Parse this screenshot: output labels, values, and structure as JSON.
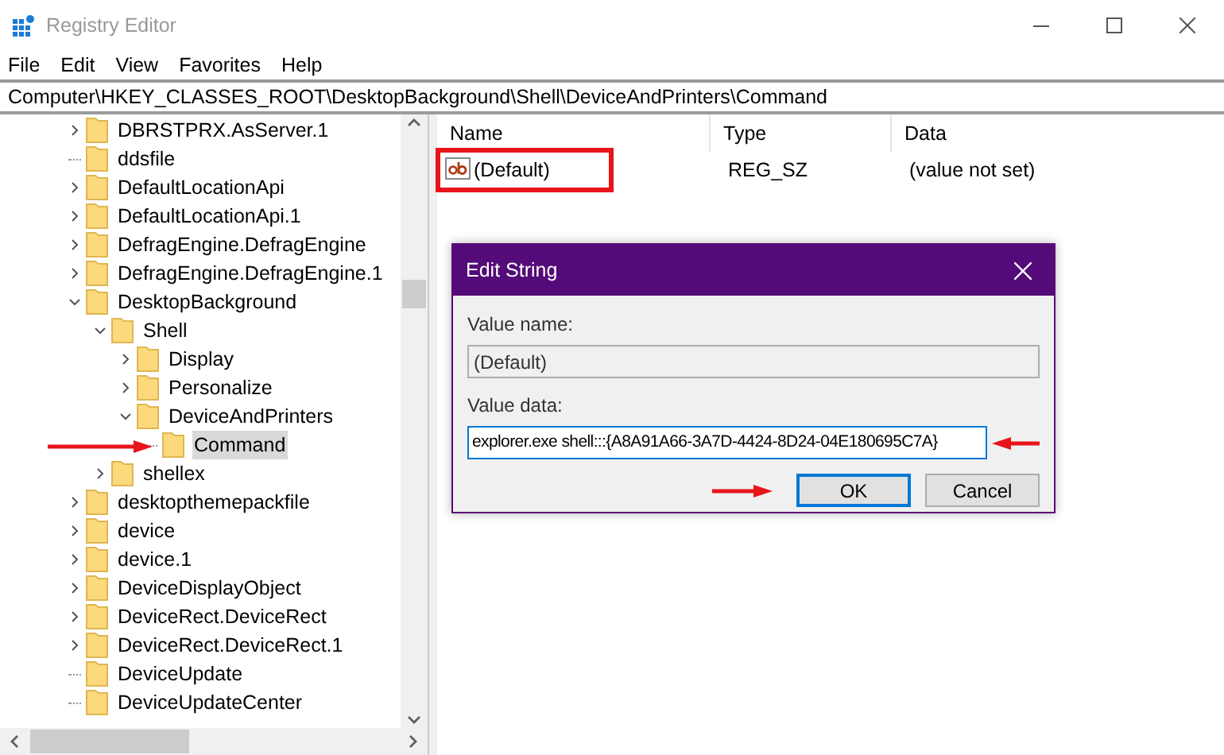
{
  "window": {
    "title": "Registry Editor"
  },
  "menu": [
    "File",
    "Edit",
    "View",
    "Favorites",
    "Help"
  ],
  "address": "Computer\\HKEY_CLASSES_ROOT\\DesktopBackground\\Shell\\DeviceAndPrinters\\Command",
  "tree": [
    {
      "label": "DBRSTPRX.AsServer.1",
      "kind": "branch",
      "expanded": false,
      "selected": false
    },
    {
      "label": "ddsfile",
      "kind": "leaf",
      "selected": false
    },
    {
      "label": "DefaultLocationApi",
      "kind": "branch",
      "expanded": false,
      "selected": false
    },
    {
      "label": "DefaultLocationApi.1",
      "kind": "branch",
      "expanded": false,
      "selected": false
    },
    {
      "label": "DefragEngine.DefragEngine",
      "kind": "branch",
      "expanded": false,
      "selected": false
    },
    {
      "label": "DefragEngine.DefragEngine.1",
      "kind": "branch",
      "expanded": false,
      "selected": false
    },
    {
      "label": "DesktopBackground",
      "kind": "branch",
      "expanded": true,
      "selected": false,
      "children": [
        {
          "label": "Shell",
          "kind": "branch",
          "expanded": true,
          "selected": false,
          "children": [
            {
              "label": "Display",
              "kind": "branch",
              "expanded": false,
              "selected": false
            },
            {
              "label": "Personalize",
              "kind": "branch",
              "expanded": false,
              "selected": false
            },
            {
              "label": "DeviceAndPrinters",
              "kind": "branch",
              "expanded": true,
              "selected": false,
              "children": [
                {
                  "label": "Command",
                  "kind": "leaf",
                  "selected": true
                }
              ]
            }
          ]
        },
        {
          "label": "shellex",
          "kind": "branch",
          "expanded": false,
          "selected": false
        }
      ]
    },
    {
      "label": "desktopthemepackfile",
      "kind": "branch",
      "expanded": false,
      "selected": false
    },
    {
      "label": "device",
      "kind": "branch",
      "expanded": false,
      "selected": false
    },
    {
      "label": "device.1",
      "kind": "branch",
      "expanded": false,
      "selected": false
    },
    {
      "label": "DeviceDisplayObject",
      "kind": "branch",
      "expanded": false,
      "selected": false
    },
    {
      "label": "DeviceRect.DeviceRect",
      "kind": "branch",
      "expanded": false,
      "selected": false
    },
    {
      "label": "DeviceRect.DeviceRect.1",
      "kind": "branch",
      "expanded": false,
      "selected": false
    },
    {
      "label": "DeviceUpdate",
      "kind": "leaf",
      "selected": false
    },
    {
      "label": "DeviceUpdateCenter",
      "kind": "leaf",
      "selected": false
    }
  ],
  "table": {
    "columns": [
      "Name",
      "Type",
      "Data"
    ],
    "rows": [
      {
        "name": "(Default)",
        "type": "REG_SZ",
        "data": "(value not set)"
      }
    ]
  },
  "dialog": {
    "title": "Edit String",
    "value_name_label": "Value name:",
    "value_name": "(Default)",
    "value_data_label": "Value data:",
    "value_data": "explorer.exe shell:::{A8A91A66-3A7D-4424-8D24-04E180695C7A}",
    "buttons": [
      {
        "label": "OK",
        "default": true
      },
      {
        "label": "Cancel",
        "default": false
      }
    ]
  }
}
